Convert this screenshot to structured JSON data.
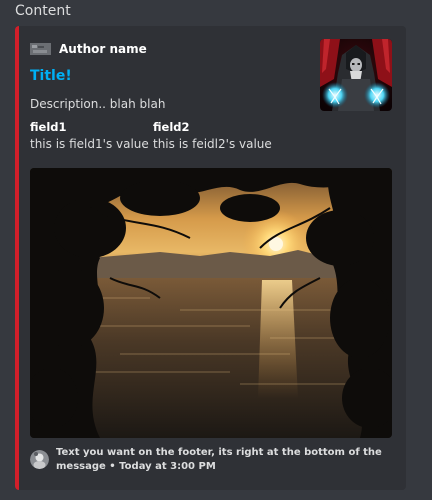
{
  "section_label": "Content",
  "embed": {
    "accent_color": "#d21f2a",
    "author": {
      "name": "Author name",
      "icon": "author-icon"
    },
    "title": "Title!",
    "title_color": "#00b0f4",
    "description": "Description.. blah blah",
    "fields": [
      {
        "name": "field1",
        "value": "this is field1's value"
      },
      {
        "name": "field2",
        "value": "this is feidl2's value"
      }
    ],
    "thumbnail": "hooded-wizard-thumbnail",
    "image": "sunset-lake-image",
    "footer": {
      "icon": "footer-avatar-icon",
      "text": "Text you want on the footer, its right at the bottom of the message",
      "separator": "•",
      "timestamp": "Today at 3:00 PM"
    }
  }
}
